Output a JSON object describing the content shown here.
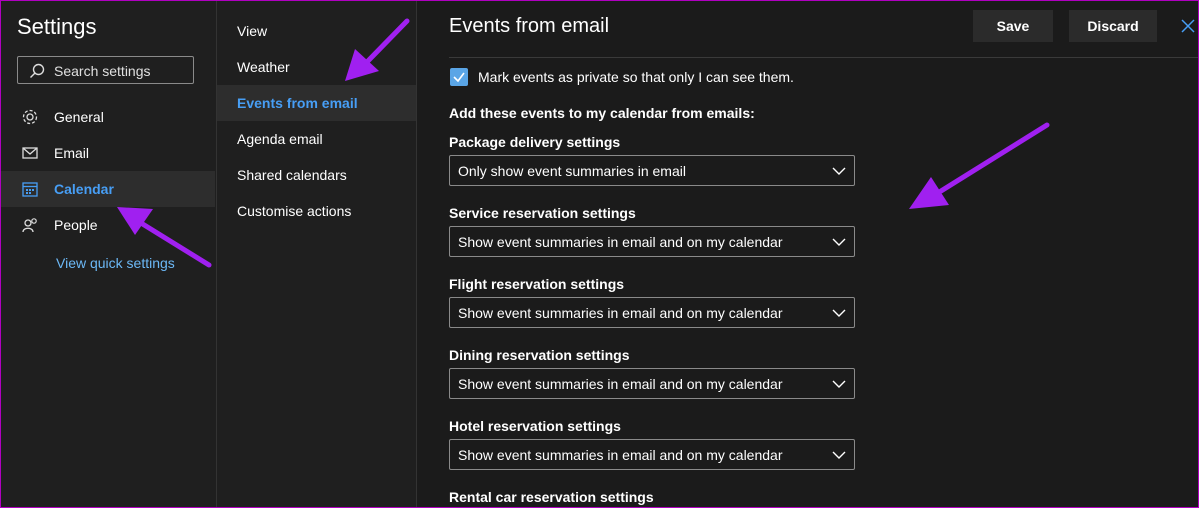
{
  "left": {
    "title": "Settings",
    "search_placeholder": "Search settings",
    "items": [
      {
        "label": "General",
        "icon": "gear-icon"
      },
      {
        "label": "Email",
        "icon": "mail-icon"
      },
      {
        "label": "Calendar",
        "icon": "calendar-icon"
      },
      {
        "label": "People",
        "icon": "people-icon"
      }
    ],
    "quick_settings": "View quick settings"
  },
  "middle": {
    "items": [
      {
        "label": "View"
      },
      {
        "label": "Weather"
      },
      {
        "label": "Events from email"
      },
      {
        "label": "Agenda email"
      },
      {
        "label": "Shared calendars"
      },
      {
        "label": "Customise actions"
      }
    ]
  },
  "main": {
    "title": "Events from email",
    "save": "Save",
    "discard": "Discard",
    "private_label": "Mark events as private so that only I can see them.",
    "private_checked": true,
    "add_heading": "Add these events to my calendar from emails:",
    "sections": [
      {
        "heading": "Package delivery settings",
        "value": "Only show event summaries in email"
      },
      {
        "heading": "Service reservation settings",
        "value": "Show event summaries in email and on my calendar"
      },
      {
        "heading": "Flight reservation settings",
        "value": "Show event summaries in email and on my calendar"
      },
      {
        "heading": "Dining reservation settings",
        "value": "Show event summaries in email and on my calendar"
      },
      {
        "heading": "Hotel reservation settings",
        "value": "Show event summaries in email and on my calendar"
      },
      {
        "heading": "Rental car reservation settings"
      }
    ]
  },
  "colors": {
    "accent": "#479ef5",
    "annotation": "#a020f0",
    "background": "#1b1b1b"
  }
}
